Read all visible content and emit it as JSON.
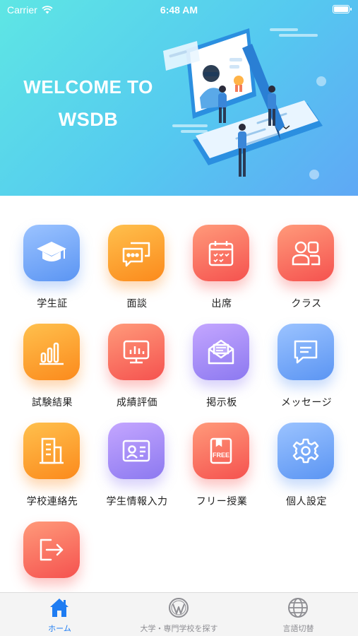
{
  "status_bar": {
    "carrier": "Carrier",
    "time": "6:48 AM"
  },
  "hero": {
    "title_line1": "WELCOME TO",
    "title_line2": "WSDB"
  },
  "menu": [
    {
      "label": "学生証",
      "icon": "graduation-cap-icon",
      "color": "blue"
    },
    {
      "label": "面談",
      "icon": "chat-bubbles-icon",
      "color": "orange"
    },
    {
      "label": "出席",
      "icon": "calendar-check-icon",
      "color": "red"
    },
    {
      "label": "クラス",
      "icon": "people-icon",
      "color": "red"
    },
    {
      "label": "試験結果",
      "icon": "bar-chart-icon",
      "color": "orange"
    },
    {
      "label": "成績評価",
      "icon": "monitor-chart-icon",
      "color": "red"
    },
    {
      "label": "掲示板",
      "icon": "envelope-icon",
      "color": "purple"
    },
    {
      "label": "メッセージ",
      "icon": "message-icon",
      "color": "blue"
    },
    {
      "label": "学校連絡先",
      "icon": "building-icon",
      "color": "orange"
    },
    {
      "label": "学生情報入力",
      "icon": "id-card-icon",
      "color": "purple"
    },
    {
      "label": "フリー授業",
      "icon": "free-book-icon",
      "color": "red"
    },
    {
      "label": "個人設定",
      "icon": "gear-icon",
      "color": "blue"
    },
    {
      "label": "",
      "icon": "logout-icon",
      "color": "red"
    }
  ],
  "free_badge": "FREE",
  "tabs": [
    {
      "label": "ホーム",
      "icon": "home-icon",
      "active": true
    },
    {
      "label": "大学・専門学校を探す",
      "icon": "wordpress-icon",
      "active": false
    },
    {
      "label": "言語切替",
      "icon": "globe-icon",
      "active": false
    }
  ],
  "colors": {
    "active_tab": "#1e7cf2",
    "inactive_tab": "#8e8e93"
  }
}
